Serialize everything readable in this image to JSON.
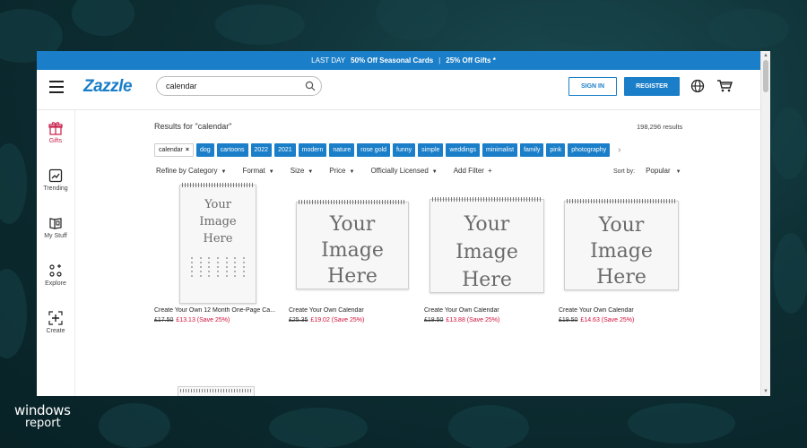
{
  "promo": {
    "part1": "LAST DAY",
    "part2": "50% Off Seasonal Cards",
    "sep": "|",
    "part3": "25% Off Gifts *"
  },
  "header": {
    "logo": "Zazzle",
    "search_value": "calendar",
    "signin_label": "SIGN IN",
    "register_label": "REGISTER",
    "accent": "#1a7ec8"
  },
  "sidebar": {
    "items": [
      {
        "label": "Gifts",
        "icon": "gift-icon"
      },
      {
        "label": "Trending",
        "icon": "trending-icon"
      },
      {
        "label": "My Stuff",
        "icon": "my-stuff-icon"
      },
      {
        "label": "Explore",
        "icon": "explore-icon"
      },
      {
        "label": "Create",
        "icon": "create-icon"
      }
    ]
  },
  "results": {
    "title": "Results for \"calendar\"",
    "count": "198,296 results"
  },
  "chips": {
    "selected": "calendar",
    "remove_glyph": "×",
    "items": [
      "dog",
      "cartoons",
      "2022",
      "2021",
      "modern",
      "nature",
      "rose gold",
      "funny",
      "simple",
      "weddings",
      "minimalist",
      "family",
      "pink",
      "photography"
    ]
  },
  "filters": {
    "items": [
      "Refine by Category",
      "Format",
      "Size",
      "Price",
      "Officially Licensed"
    ],
    "add_filter": "Add Filter",
    "sort_label": "Sort by:",
    "sort_value": "Popular"
  },
  "placeholder_text": [
    "Your",
    "Image",
    "Here"
  ],
  "products": [
    {
      "title": "Create Your Own 12 Month One-Page Ca...",
      "old_price": "£17.50",
      "new_price": "£13.13 (Save 25%)"
    },
    {
      "title": "Create Your Own Calendar",
      "old_price": "£25.35",
      "new_price": "£19.02 (Save 25%)"
    },
    {
      "title": "Create Your Own Calendar",
      "old_price": "£18.50",
      "new_price": "£13.88 (Save 25%)"
    },
    {
      "title": "Create Your Own Calendar",
      "old_price": "£19.50",
      "new_price": "£14.63 (Save 25%)"
    }
  ],
  "watermark": {
    "line1": "windows",
    "line2": "report"
  }
}
